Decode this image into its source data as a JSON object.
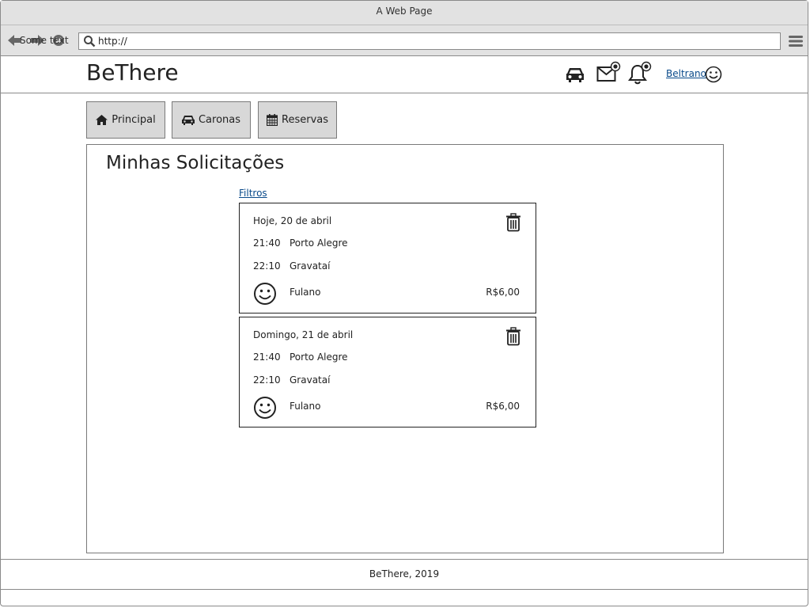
{
  "window": {
    "title": "A Web Page"
  },
  "toolbar": {
    "overlay_text": "Some text",
    "address_value": "http://",
    "icons": [
      "back-arrow-icon",
      "forward-arrow-icon",
      "close-icon",
      "search-icon",
      "hamburger-menu-icon"
    ]
  },
  "header": {
    "brand": "BeThere",
    "user_name": "Beltrano",
    "icons": [
      "car-icon",
      "mail-icon",
      "bell-icon",
      "smiley-icon"
    ]
  },
  "tabs": [
    {
      "label": "Principal",
      "icon": "home-icon"
    },
    {
      "label": "Caronas",
      "icon": "car-icon"
    },
    {
      "label": "Reservas",
      "icon": "calendar-icon"
    }
  ],
  "main": {
    "title": "Minhas Solicitações",
    "filters_label": "Filtros",
    "requests": [
      {
        "date": "Hoje, 20 de abril",
        "depart_time": "21:40",
        "origin": "Porto Alegre",
        "arrive_time": "22:10",
        "destination": "Gravataí",
        "driver": "Fulano",
        "price": "R$6,00"
      },
      {
        "date": "Domingo, 21 de abril",
        "depart_time": "21:40",
        "origin": "Porto Alegre",
        "arrive_time": "22:10",
        "destination": "Gravataí",
        "driver": "Fulano",
        "price": "R$6,00"
      }
    ]
  },
  "footer": {
    "text": "BeThere, 2019"
  }
}
